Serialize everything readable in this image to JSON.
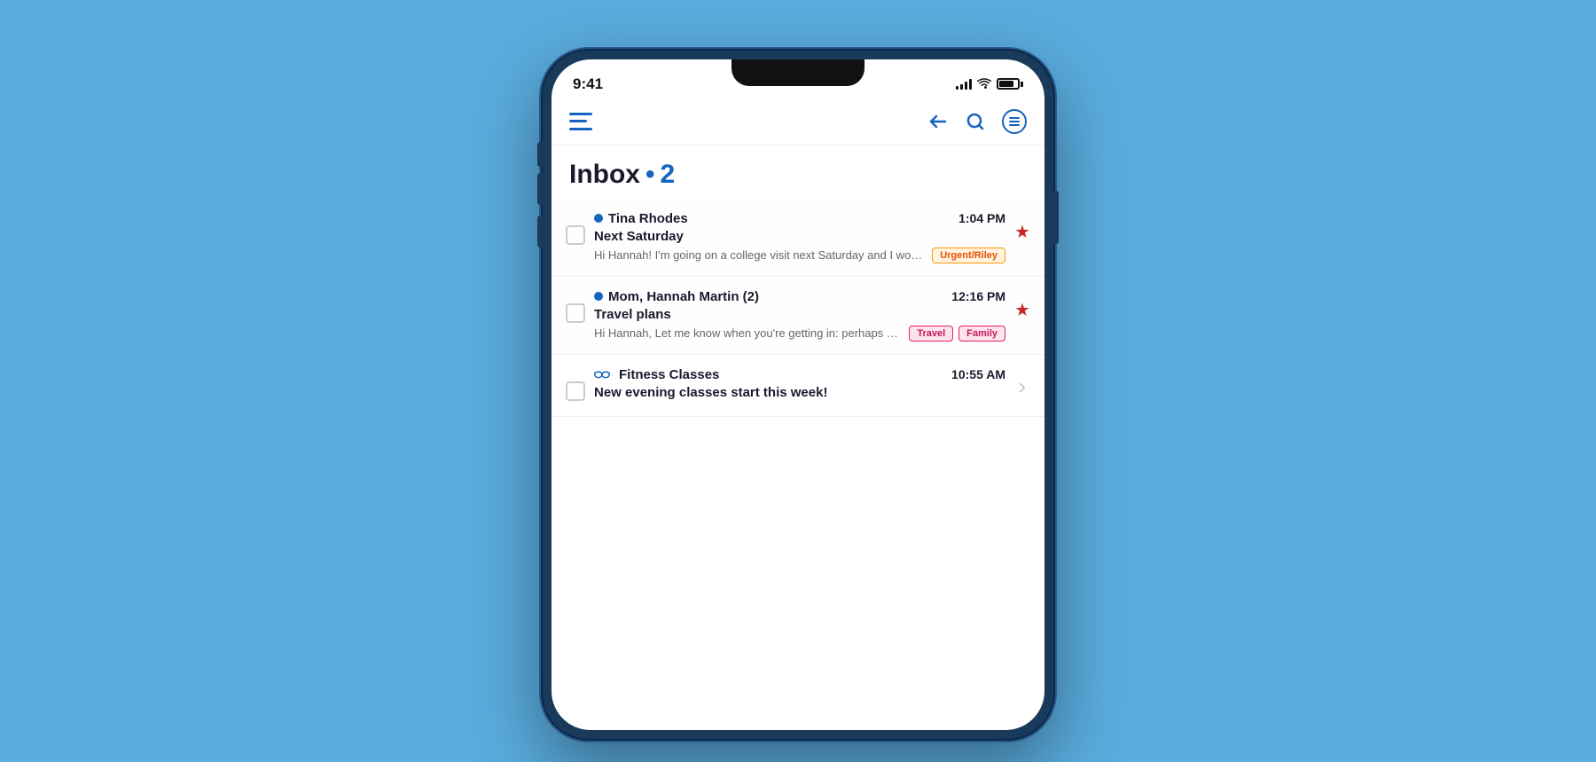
{
  "phone": {
    "status_bar": {
      "time": "9:41",
      "signal_bars": [
        4,
        6,
        9,
        12,
        12
      ],
      "wifi": true,
      "battery_percent": 85
    },
    "header": {
      "menu_icon": "hamburger",
      "back_label": "back",
      "search_label": "search",
      "filter_label": "filter"
    },
    "inbox": {
      "title": "Inbox",
      "dot": "•",
      "count": "2"
    },
    "emails": [
      {
        "id": 1,
        "unread": true,
        "sender": "Tina Rhodes",
        "time": "1:04 PM",
        "subject": "Next Saturday",
        "preview": "Hi Hannah! I'm going on a college visit next Saturday and I won't be back in time to watch I",
        "tags": [
          {
            "label": "Urgent/Riley",
            "style": "urgent"
          }
        ],
        "pinned": true,
        "icon": null
      },
      {
        "id": 2,
        "unread": true,
        "sender": "Mom, Hannah Martin (2)",
        "time": "12:16 PM",
        "subject": "Travel plans",
        "preview": "Hi Hannah, Let me know when you're getting in: perhaps we can pick you up if yo",
        "tags": [
          {
            "label": "Travel",
            "style": "travel"
          },
          {
            "label": "Family",
            "style": "family"
          }
        ],
        "pinned": true,
        "icon": null
      },
      {
        "id": 3,
        "unread": false,
        "sender": "Fitness Classes",
        "time": "10:55 AM",
        "subject": "New evening classes start this week!",
        "preview": "",
        "tags": [],
        "pinned": false,
        "icon": "glasses"
      }
    ]
  },
  "colors": {
    "background": "#5aacde",
    "accent_blue": "#1565c0",
    "unread_dot": "#1565c0",
    "pin": "#c62828",
    "tag_urgent_bg": "#fff3e0",
    "tag_urgent_text": "#e65100",
    "tag_urgent_border": "#ff9800",
    "tag_travel_bg": "#fce4ec",
    "tag_travel_text": "#c2185b",
    "tag_travel_border": "#e91e63",
    "tag_family_bg": "#fce4ec",
    "tag_family_text": "#c2185b",
    "tag_family_border": "#e91e63"
  }
}
